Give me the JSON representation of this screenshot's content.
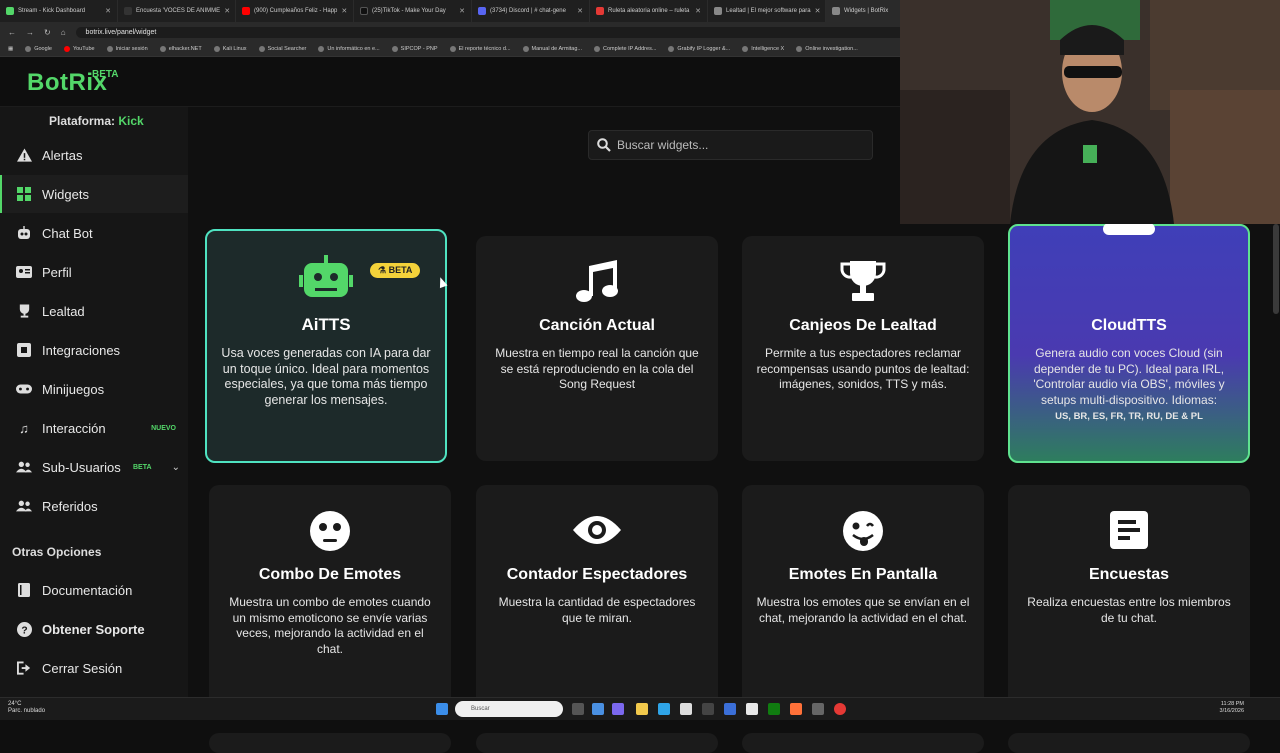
{
  "browser": {
    "tabs": [
      {
        "label": "Stream - Kick Dashboard",
        "color": "#53d769"
      },
      {
        "label": "Encuesta 'VOCES DE ANIMME",
        "color": "#222222"
      },
      {
        "label": "(900) Cumpleaños Feliz - Happ",
        "color": "#ff0000"
      },
      {
        "label": "(25)TikTok - Make Your Day",
        "color": "#111111"
      },
      {
        "label": "(3734) Discord | # chat-gene",
        "color": "#5865f2"
      },
      {
        "label": "Ruleta aleatoria online – ruleta",
        "color": "#e53935"
      },
      {
        "label": "Lealtad | El mejor software para",
        "color": "#888888"
      },
      {
        "label": "Widgets | BotRix",
        "color": "#888888"
      }
    ],
    "url": "botrix.live/panel/widget",
    "bookmarks": [
      "Google",
      "YouTube",
      "Iniciar sesión",
      "elhacker.NET",
      "Kali Linux",
      "Social Searcher",
      "Un informático en e...",
      "SIPCOP - PNP",
      "El reporte técnico d...",
      "Manual de Armitag...",
      "Complete IP Addres...",
      "Grabify IP Logger &...",
      "Intelligence X",
      "Online investigation..."
    ]
  },
  "app": {
    "logo": "BotRix",
    "logo_badge": "BETA",
    "platform_label": "Plataforma:",
    "platform_value": "Kick",
    "accent": "#53d769"
  },
  "sidebar": {
    "items": [
      {
        "label": "Alertas",
        "icon": "warning-icon"
      },
      {
        "label": "Widgets",
        "icon": "grid-icon"
      },
      {
        "label": "Chat Bot",
        "icon": "robot-icon"
      },
      {
        "label": "Perfil",
        "icon": "id-card-icon"
      },
      {
        "label": "Lealtad",
        "icon": "trophy-icon"
      },
      {
        "label": "Integraciones",
        "icon": "plug-icon"
      },
      {
        "label": "Minijuegos",
        "icon": "gamepad-icon"
      },
      {
        "label": "Interacción",
        "icon": "music-icon",
        "tag": "NUEVO"
      },
      {
        "label": "Sub-Usuarios",
        "icon": "users-icon",
        "tag": "BETA"
      },
      {
        "label": "Referidos",
        "icon": "user-group-icon"
      }
    ],
    "other_title": "Otras Opciones",
    "other_items": [
      {
        "label": "Documentación",
        "icon": "book-icon"
      },
      {
        "label": "Obtener Soporte",
        "icon": "help-icon"
      },
      {
        "label": "Cerrar Sesión",
        "icon": "logout-icon"
      }
    ]
  },
  "search": {
    "placeholder": "Buscar widgets..."
  },
  "cards": [
    {
      "title": "AiTTS",
      "badge": "BETA",
      "icon": "robot-icon",
      "desc": "Usa voces generadas con IA para dar un toque único. Ideal para momentos especiales, ya que toma más tiempo generar los mensajes."
    },
    {
      "title": "Canción Actual",
      "icon": "music-note-icon",
      "desc": "Muestra en tiempo real la canción que se está reproduciendo en la cola del Song Request"
    },
    {
      "title": "Canjeos De Lealtad",
      "icon": "trophy-icon",
      "desc": "Permite a tus espectadores reclamar recompensas usando puntos de lealtad: imágenes, sonidos, TTS y más."
    },
    {
      "title": "CloudTTS",
      "icon": "cloud-icon",
      "desc": "Genera audio con voces Cloud (sin depender de tu PC). Ideal para IRL, 'Controlar audio vía OBS', móviles y setups multi-dispositivo. Idiomas:",
      "langs": "US, BR, ES, FR, TR, RU, DE & PL"
    },
    {
      "title": "Combo De Emotes",
      "icon": "emote-face-icon",
      "desc": "Muestra un combo de emotes cuando un mismo emoticono se envíe varias veces, mejorando la actividad en el chat."
    },
    {
      "title": "Contador Espectadores",
      "icon": "eye-icon",
      "desc": "Muestra la cantidad de espectadores que te miran."
    },
    {
      "title": "Emotes En Pantalla",
      "icon": "tongue-face-icon",
      "desc": "Muestra los emotes que se envían en el chat, mejorando la actividad en el chat."
    },
    {
      "title": "Encuestas",
      "icon": "poll-icon",
      "desc": "Realiza encuestas entre los miembros de tu chat."
    }
  ],
  "taskbar": {
    "weather_temp": "24°C",
    "weather_desc": "Parc. nublado",
    "search_placeholder": "Buscar",
    "time": "11:28 PM",
    "date": "3/16/2026"
  }
}
